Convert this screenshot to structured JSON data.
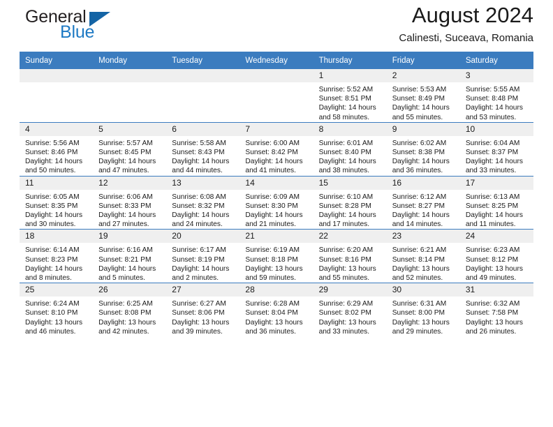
{
  "brand": {
    "name_top": "General",
    "name_bottom": "Blue",
    "accent_color": "#1464a5",
    "blue_text_color": "#1f7ac4"
  },
  "header": {
    "title": "August 2024",
    "subtitle": "Calinesti, Suceava, Romania",
    "header_bg": "#3b7cbf",
    "daynum_bg": "#efefef"
  },
  "weekdays": [
    "Sunday",
    "Monday",
    "Tuesday",
    "Wednesday",
    "Thursday",
    "Friday",
    "Saturday"
  ],
  "labels": {
    "sunrise": "Sunrise:",
    "sunset": "Sunset:",
    "daylight": "Daylight:"
  },
  "weeks": [
    [
      {
        "day": "",
        "sunrise": "",
        "sunset": "",
        "daylight1": "",
        "daylight2": ""
      },
      {
        "day": "",
        "sunrise": "",
        "sunset": "",
        "daylight1": "",
        "daylight2": ""
      },
      {
        "day": "",
        "sunrise": "",
        "sunset": "",
        "daylight1": "",
        "daylight2": ""
      },
      {
        "day": "",
        "sunrise": "",
        "sunset": "",
        "daylight1": "",
        "daylight2": ""
      },
      {
        "day": "1",
        "sunrise": "Sunrise: 5:52 AM",
        "sunset": "Sunset: 8:51 PM",
        "daylight1": "Daylight: 14 hours",
        "daylight2": "and 58 minutes."
      },
      {
        "day": "2",
        "sunrise": "Sunrise: 5:53 AM",
        "sunset": "Sunset: 8:49 PM",
        "daylight1": "Daylight: 14 hours",
        "daylight2": "and 55 minutes."
      },
      {
        "day": "3",
        "sunrise": "Sunrise: 5:55 AM",
        "sunset": "Sunset: 8:48 PM",
        "daylight1": "Daylight: 14 hours",
        "daylight2": "and 53 minutes."
      }
    ],
    [
      {
        "day": "4",
        "sunrise": "Sunrise: 5:56 AM",
        "sunset": "Sunset: 8:46 PM",
        "daylight1": "Daylight: 14 hours",
        "daylight2": "and 50 minutes."
      },
      {
        "day": "5",
        "sunrise": "Sunrise: 5:57 AM",
        "sunset": "Sunset: 8:45 PM",
        "daylight1": "Daylight: 14 hours",
        "daylight2": "and 47 minutes."
      },
      {
        "day": "6",
        "sunrise": "Sunrise: 5:58 AM",
        "sunset": "Sunset: 8:43 PM",
        "daylight1": "Daylight: 14 hours",
        "daylight2": "and 44 minutes."
      },
      {
        "day": "7",
        "sunrise": "Sunrise: 6:00 AM",
        "sunset": "Sunset: 8:42 PM",
        "daylight1": "Daylight: 14 hours",
        "daylight2": "and 41 minutes."
      },
      {
        "day": "8",
        "sunrise": "Sunrise: 6:01 AM",
        "sunset": "Sunset: 8:40 PM",
        "daylight1": "Daylight: 14 hours",
        "daylight2": "and 38 minutes."
      },
      {
        "day": "9",
        "sunrise": "Sunrise: 6:02 AM",
        "sunset": "Sunset: 8:38 PM",
        "daylight1": "Daylight: 14 hours",
        "daylight2": "and 36 minutes."
      },
      {
        "day": "10",
        "sunrise": "Sunrise: 6:04 AM",
        "sunset": "Sunset: 8:37 PM",
        "daylight1": "Daylight: 14 hours",
        "daylight2": "and 33 minutes."
      }
    ],
    [
      {
        "day": "11",
        "sunrise": "Sunrise: 6:05 AM",
        "sunset": "Sunset: 8:35 PM",
        "daylight1": "Daylight: 14 hours",
        "daylight2": "and 30 minutes."
      },
      {
        "day": "12",
        "sunrise": "Sunrise: 6:06 AM",
        "sunset": "Sunset: 8:33 PM",
        "daylight1": "Daylight: 14 hours",
        "daylight2": "and 27 minutes."
      },
      {
        "day": "13",
        "sunrise": "Sunrise: 6:08 AM",
        "sunset": "Sunset: 8:32 PM",
        "daylight1": "Daylight: 14 hours",
        "daylight2": "and 24 minutes."
      },
      {
        "day": "14",
        "sunrise": "Sunrise: 6:09 AM",
        "sunset": "Sunset: 8:30 PM",
        "daylight1": "Daylight: 14 hours",
        "daylight2": "and 21 minutes."
      },
      {
        "day": "15",
        "sunrise": "Sunrise: 6:10 AM",
        "sunset": "Sunset: 8:28 PM",
        "daylight1": "Daylight: 14 hours",
        "daylight2": "and 17 minutes."
      },
      {
        "day": "16",
        "sunrise": "Sunrise: 6:12 AM",
        "sunset": "Sunset: 8:27 PM",
        "daylight1": "Daylight: 14 hours",
        "daylight2": "and 14 minutes."
      },
      {
        "day": "17",
        "sunrise": "Sunrise: 6:13 AM",
        "sunset": "Sunset: 8:25 PM",
        "daylight1": "Daylight: 14 hours",
        "daylight2": "and 11 minutes."
      }
    ],
    [
      {
        "day": "18",
        "sunrise": "Sunrise: 6:14 AM",
        "sunset": "Sunset: 8:23 PM",
        "daylight1": "Daylight: 14 hours",
        "daylight2": "and 8 minutes."
      },
      {
        "day": "19",
        "sunrise": "Sunrise: 6:16 AM",
        "sunset": "Sunset: 8:21 PM",
        "daylight1": "Daylight: 14 hours",
        "daylight2": "and 5 minutes."
      },
      {
        "day": "20",
        "sunrise": "Sunrise: 6:17 AM",
        "sunset": "Sunset: 8:19 PM",
        "daylight1": "Daylight: 14 hours",
        "daylight2": "and 2 minutes."
      },
      {
        "day": "21",
        "sunrise": "Sunrise: 6:19 AM",
        "sunset": "Sunset: 8:18 PM",
        "daylight1": "Daylight: 13 hours",
        "daylight2": "and 59 minutes."
      },
      {
        "day": "22",
        "sunrise": "Sunrise: 6:20 AM",
        "sunset": "Sunset: 8:16 PM",
        "daylight1": "Daylight: 13 hours",
        "daylight2": "and 55 minutes."
      },
      {
        "day": "23",
        "sunrise": "Sunrise: 6:21 AM",
        "sunset": "Sunset: 8:14 PM",
        "daylight1": "Daylight: 13 hours",
        "daylight2": "and 52 minutes."
      },
      {
        "day": "24",
        "sunrise": "Sunrise: 6:23 AM",
        "sunset": "Sunset: 8:12 PM",
        "daylight1": "Daylight: 13 hours",
        "daylight2": "and 49 minutes."
      }
    ],
    [
      {
        "day": "25",
        "sunrise": "Sunrise: 6:24 AM",
        "sunset": "Sunset: 8:10 PM",
        "daylight1": "Daylight: 13 hours",
        "daylight2": "and 46 minutes."
      },
      {
        "day": "26",
        "sunrise": "Sunrise: 6:25 AM",
        "sunset": "Sunset: 8:08 PM",
        "daylight1": "Daylight: 13 hours",
        "daylight2": "and 42 minutes."
      },
      {
        "day": "27",
        "sunrise": "Sunrise: 6:27 AM",
        "sunset": "Sunset: 8:06 PM",
        "daylight1": "Daylight: 13 hours",
        "daylight2": "and 39 minutes."
      },
      {
        "day": "28",
        "sunrise": "Sunrise: 6:28 AM",
        "sunset": "Sunset: 8:04 PM",
        "daylight1": "Daylight: 13 hours",
        "daylight2": "and 36 minutes."
      },
      {
        "day": "29",
        "sunrise": "Sunrise: 6:29 AM",
        "sunset": "Sunset: 8:02 PM",
        "daylight1": "Daylight: 13 hours",
        "daylight2": "and 33 minutes."
      },
      {
        "day": "30",
        "sunrise": "Sunrise: 6:31 AM",
        "sunset": "Sunset: 8:00 PM",
        "daylight1": "Daylight: 13 hours",
        "daylight2": "and 29 minutes."
      },
      {
        "day": "31",
        "sunrise": "Sunrise: 6:32 AM",
        "sunset": "Sunset: 7:58 PM",
        "daylight1": "Daylight: 13 hours",
        "daylight2": "and 26 minutes."
      }
    ]
  ]
}
